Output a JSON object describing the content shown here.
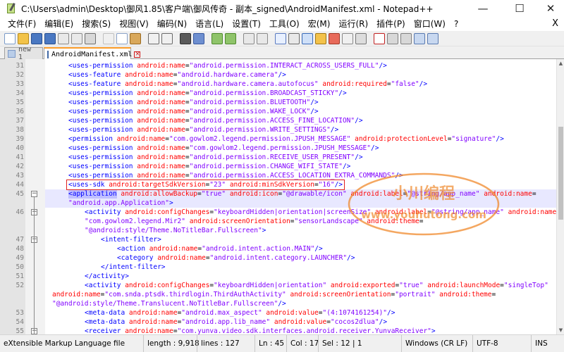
{
  "window": {
    "title": "C:\\Users\\admin\\Desktop\\御风1.85\\客户端\\御风传奇 - 副本_signed\\AndroidManifest.xml - Notepad++",
    "minimize": "—",
    "maximize": "☐",
    "close": "✕"
  },
  "menu": {
    "items": [
      "文件(F)",
      "编辑(E)",
      "搜索(S)",
      "视图(V)",
      "编码(N)",
      "语言(L)",
      "设置(T)",
      "工具(O)",
      "宏(M)",
      "运行(R)",
      "插件(P)",
      "窗口(W)",
      "?"
    ],
    "close_glyph": "X"
  },
  "tabs": [
    {
      "label": "new 1",
      "active": false
    },
    {
      "label": "AndroidManifest.xml",
      "active": true
    }
  ],
  "editor": {
    "lines": [
      {
        "n": "31",
        "indent": 1,
        "fold": "",
        "parts": [
          [
            "t",
            "<uses-permission "
          ],
          [
            "a",
            "android:name"
          ],
          [
            "p",
            "="
          ],
          [
            "v",
            "\"android.permission.INTERACT_ACROSS_USERS_FULL\""
          ],
          [
            "t",
            "/>"
          ]
        ]
      },
      {
        "n": "32",
        "indent": 1,
        "fold": "",
        "parts": [
          [
            "t",
            "<uses-feature "
          ],
          [
            "a",
            "android:name"
          ],
          [
            "p",
            "="
          ],
          [
            "v",
            "\"android.hardware.camera\""
          ],
          [
            "t",
            "/>"
          ]
        ]
      },
      {
        "n": "33",
        "indent": 1,
        "fold": "",
        "parts": [
          [
            "t",
            "<uses-feature "
          ],
          [
            "a",
            "android:name"
          ],
          [
            "p",
            "="
          ],
          [
            "v",
            "\"android.hardware.camera.autofocus\" "
          ],
          [
            "a",
            "android:required"
          ],
          [
            "p",
            "="
          ],
          [
            "v",
            "\"false\""
          ],
          [
            "t",
            "/>"
          ]
        ]
      },
      {
        "n": "34",
        "indent": 1,
        "fold": "",
        "parts": [
          [
            "t",
            "<uses-permission "
          ],
          [
            "a",
            "android:name"
          ],
          [
            "p",
            "="
          ],
          [
            "v",
            "\"android.permission.BROADCAST_STICKY\""
          ],
          [
            "t",
            "/>"
          ]
        ]
      },
      {
        "n": "35",
        "indent": 1,
        "fold": "",
        "parts": [
          [
            "t",
            "<uses-permission "
          ],
          [
            "a",
            "android:name"
          ],
          [
            "p",
            "="
          ],
          [
            "v",
            "\"android.permission.BLUETOOTH\""
          ],
          [
            "t",
            "/>"
          ]
        ]
      },
      {
        "n": "36",
        "indent": 1,
        "fold": "",
        "parts": [
          [
            "t",
            "<uses-permission "
          ],
          [
            "a",
            "android:name"
          ],
          [
            "p",
            "="
          ],
          [
            "v",
            "\"android.permission.WAKE_LOCK\""
          ],
          [
            "t",
            "/>"
          ]
        ]
      },
      {
        "n": "37",
        "indent": 1,
        "fold": "",
        "parts": [
          [
            "t",
            "<uses-permission "
          ],
          [
            "a",
            "android:name"
          ],
          [
            "p",
            "="
          ],
          [
            "v",
            "\"android.permission.ACCESS_FINE_LOCATION\""
          ],
          [
            "t",
            "/>"
          ]
        ]
      },
      {
        "n": "38",
        "indent": 1,
        "fold": "",
        "parts": [
          [
            "t",
            "<uses-permission "
          ],
          [
            "a",
            "android:name"
          ],
          [
            "p",
            "="
          ],
          [
            "v",
            "\"android.permission.WRITE_SETTINGS\""
          ],
          [
            "t",
            "/>"
          ]
        ]
      },
      {
        "n": "39",
        "indent": 1,
        "fold": "",
        "parts": [
          [
            "t",
            "<permission "
          ],
          [
            "a",
            "android:name"
          ],
          [
            "p",
            "="
          ],
          [
            "v",
            "\"com.gowlom2.legend.permission.JPUSH_MESSAGE\" "
          ],
          [
            "a",
            "android:protectionLevel"
          ],
          [
            "p",
            "="
          ],
          [
            "v",
            "\"signature\""
          ],
          [
            "t",
            "/>"
          ]
        ]
      },
      {
        "n": "40",
        "indent": 1,
        "fold": "",
        "parts": [
          [
            "t",
            "<uses-permission "
          ],
          [
            "a",
            "android:name"
          ],
          [
            "p",
            "="
          ],
          [
            "v",
            "\"com.gowlom2.legend.permission.JPUSH_MESSAGE\""
          ],
          [
            "t",
            "/>"
          ]
        ]
      },
      {
        "n": "41",
        "indent": 1,
        "fold": "",
        "parts": [
          [
            "t",
            "<uses-permission "
          ],
          [
            "a",
            "android:name"
          ],
          [
            "p",
            "="
          ],
          [
            "v",
            "\"android.permission.RECEIVE_USER_PRESENT\""
          ],
          [
            "t",
            "/>"
          ]
        ]
      },
      {
        "n": "42",
        "indent": 1,
        "fold": "",
        "parts": [
          [
            "t",
            "<uses-permission "
          ],
          [
            "a",
            "android:name"
          ],
          [
            "p",
            "="
          ],
          [
            "v",
            "\"android.permission.CHANGE_WIFI_STATE\""
          ],
          [
            "t",
            "/>"
          ]
        ]
      },
      {
        "n": "43",
        "indent": 1,
        "fold": "",
        "parts": [
          [
            "t",
            "<uses-permission "
          ],
          [
            "a",
            "android:name"
          ],
          [
            "p",
            "="
          ],
          [
            "v",
            "\"android.permission.ACCESS_LOCATION_EXTRA_COMMANDS\""
          ],
          [
            "t",
            "/>"
          ]
        ]
      },
      {
        "n": "44",
        "indent": 1,
        "fold": "",
        "parts": [
          [
            "t",
            "<uses-sdk "
          ],
          [
            "a",
            "android:targetSdkVersion"
          ],
          [
            "p",
            "="
          ],
          [
            "v",
            "\"23\" "
          ],
          [
            "a",
            "android:minSdkVersion"
          ],
          [
            "p",
            "="
          ],
          [
            "v",
            "\"16\""
          ],
          [
            "t",
            "/>"
          ]
        ]
      },
      {
        "n": "45",
        "indent": 1,
        "fold": "open",
        "current": true,
        "parts": [
          [
            "t",
            "<application "
          ],
          [
            "a",
            "android:allowBackup"
          ],
          [
            "p",
            "="
          ],
          [
            "v",
            "\"true\" "
          ],
          [
            "a",
            "android:icon"
          ],
          [
            "p",
            "="
          ],
          [
            "v",
            "\"@drawable/icon\" "
          ],
          [
            "a",
            "android:label"
          ],
          [
            "p",
            "="
          ],
          [
            "v",
            "\"@string/app_name\" "
          ],
          [
            "a",
            "android:name"
          ],
          [
            "p",
            "="
          ]
        ]
      },
      {
        "n": "",
        "indent": 1,
        "fold": "",
        "current": true,
        "parts": [
          [
            "v",
            "\"android.app.Application\""
          ],
          [
            "t",
            ">"
          ]
        ]
      },
      {
        "n": "46",
        "indent": 2,
        "fold": "open",
        "parts": [
          [
            "t",
            "<activity "
          ],
          [
            "a",
            "android:configChanges"
          ],
          [
            "p",
            "="
          ],
          [
            "v",
            "\"keyboardHidden|orientation|screenSize\" "
          ],
          [
            "a",
            "android:label"
          ],
          [
            "p",
            "="
          ],
          [
            "v",
            "\"@string/app_name\" "
          ],
          [
            "a",
            "android:name"
          ],
          [
            "p",
            "="
          ]
        ]
      },
      {
        "n": "",
        "indent": 2,
        "fold": "",
        "parts": [
          [
            "v",
            "\"com.gowlom2.legend.Mir2\" "
          ],
          [
            "a",
            "android:screenOrientation"
          ],
          [
            "p",
            "="
          ],
          [
            "v",
            "\"sensorLandscape\" "
          ],
          [
            "a",
            "android:theme"
          ],
          [
            "p",
            "="
          ]
        ]
      },
      {
        "n": "",
        "indent": 2,
        "fold": "",
        "parts": [
          [
            "v",
            "\"@android:style/Theme.NoTitleBar.Fullscreen\""
          ],
          [
            "t",
            ">"
          ]
        ]
      },
      {
        "n": "47",
        "indent": 3,
        "fold": "open",
        "parts": [
          [
            "t",
            "<intent-filter>"
          ]
        ]
      },
      {
        "n": "48",
        "indent": 4,
        "fold": "",
        "parts": [
          [
            "t",
            "<action "
          ],
          [
            "a",
            "android:name"
          ],
          [
            "p",
            "="
          ],
          [
            "v",
            "\"android.intent.action.MAIN\""
          ],
          [
            "t",
            "/>"
          ]
        ]
      },
      {
        "n": "49",
        "indent": 4,
        "fold": "",
        "parts": [
          [
            "t",
            "<category "
          ],
          [
            "a",
            "android:name"
          ],
          [
            "p",
            "="
          ],
          [
            "v",
            "\"android.intent.category.LAUNCHER\""
          ],
          [
            "t",
            "/>"
          ]
        ]
      },
      {
        "n": "50",
        "indent": 3,
        "fold": "",
        "parts": [
          [
            "t",
            "</intent-filter>"
          ]
        ]
      },
      {
        "n": "51",
        "indent": 2,
        "fold": "",
        "parts": [
          [
            "t",
            "</activity>"
          ]
        ]
      },
      {
        "n": "52",
        "indent": 2,
        "fold": "",
        "parts": [
          [
            "t",
            "<activity "
          ],
          [
            "a",
            "android:configChanges"
          ],
          [
            "p",
            "="
          ],
          [
            "v",
            "\"keyboardHidden|orientation\" "
          ],
          [
            "a",
            "android:exported"
          ],
          [
            "p",
            "="
          ],
          [
            "v",
            "\"true\" "
          ],
          [
            "a",
            "android:launchMode"
          ],
          [
            "p",
            "="
          ],
          [
            "v",
            "\"singleTop\""
          ]
        ]
      },
      {
        "n": "",
        "indent": 0,
        "fold": "",
        "parts": [
          [
            "a",
            "android:name"
          ],
          [
            "p",
            "="
          ],
          [
            "v",
            "\"com.snda.ptsdk.thirdlogin.ThirdAuthActivity\" "
          ],
          [
            "a",
            "android:screenOrientation"
          ],
          [
            "p",
            "="
          ],
          [
            "v",
            "\"portrait\" "
          ],
          [
            "a",
            "android:theme"
          ],
          [
            "p",
            "="
          ]
        ]
      },
      {
        "n": "",
        "indent": 0,
        "fold": "",
        "parts": [
          [
            "v",
            "\"@android:style/Theme.Translucent.NoTitleBar.Fullscreen\""
          ],
          [
            "t",
            "/>"
          ]
        ]
      },
      {
        "n": "53",
        "indent": 2,
        "fold": "",
        "parts": [
          [
            "t",
            "<meta-data "
          ],
          [
            "a",
            "android:name"
          ],
          [
            "p",
            "="
          ],
          [
            "v",
            "\"android.max_aspect\" "
          ],
          [
            "a",
            "android:value"
          ],
          [
            "p",
            "="
          ],
          [
            "v",
            "\"(4:1074161254)\""
          ],
          [
            "t",
            "/>"
          ]
        ]
      },
      {
        "n": "54",
        "indent": 2,
        "fold": "",
        "parts": [
          [
            "t",
            "<meta-data "
          ],
          [
            "a",
            "android:name"
          ],
          [
            "p",
            "="
          ],
          [
            "v",
            "\"android.app.lib_name\" "
          ],
          [
            "a",
            "android:value"
          ],
          [
            "p",
            "="
          ],
          [
            "v",
            "\"cocos2dlua\""
          ],
          [
            "t",
            "/>"
          ]
        ]
      },
      {
        "n": "55",
        "indent": 2,
        "fold": "open",
        "parts": [
          [
            "t",
            "<receiver "
          ],
          [
            "a",
            "android:name"
          ],
          [
            "p",
            "="
          ],
          [
            "v",
            "\"com.yunva.video.sdk.interfaces.android.receiver.YunvaReceiver\""
          ],
          [
            "t",
            ">"
          ]
        ]
      },
      {
        "n": "56",
        "indent": 3,
        "fold": "",
        "parts": [
          [
            "t",
            "<intent-filter "
          ],
          [
            "a",
            "android:priority"
          ],
          [
            "p",
            "="
          ],
          [
            "v",
            "\"2147483647\""
          ],
          [
            "t",
            ">"
          ]
        ]
      }
    ]
  },
  "watermark": {
    "line1": "小川编程",
    "line2": "www.youhutong.com",
    "color": "#f08a2c"
  },
  "statusbar": {
    "filetype": "eXtensible Markup Language file",
    "length": "length : 9,918",
    "lines": "lines : 127",
    "ln": "Ln : 45",
    "col": "Col : 17",
    "sel": "Sel : 12 | 1",
    "eol": "Windows (CR LF)",
    "encoding": "UTF-8",
    "mode": "INS"
  },
  "colors": {
    "tag": "#0000ff",
    "attribute": "#ff0000",
    "value": "#8000ff",
    "current_line": "#e8e8ff",
    "selection": "#c0c0ff",
    "tab_accent": "#fa9b28",
    "annotation_box": "#e02020"
  }
}
